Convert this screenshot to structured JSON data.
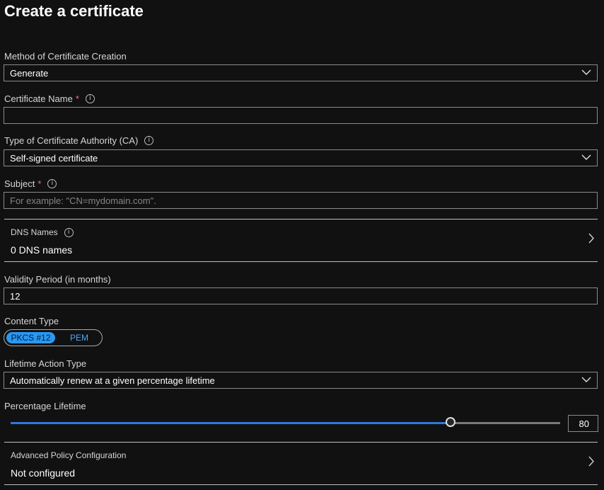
{
  "page": {
    "title": "Create a certificate"
  },
  "method": {
    "label": "Method of Certificate Creation",
    "value": "Generate"
  },
  "cert_name": {
    "label": "Certificate Name",
    "required_mark": "*",
    "info_icon": "i",
    "value": ""
  },
  "ca_type": {
    "label": "Type of Certificate Authority (CA)",
    "info_icon": "i",
    "value": "Self-signed certificate"
  },
  "subject": {
    "label": "Subject",
    "required_mark": "*",
    "info_icon": "i",
    "placeholder": "For example: \"CN=mydomain.com\"."
  },
  "dns": {
    "label": "DNS Names",
    "info_icon": "i",
    "value": "0 DNS names"
  },
  "validity": {
    "label": "Validity Period (in months)",
    "value": "12"
  },
  "content_type": {
    "label": "Content Type",
    "options": [
      "PKCS #12",
      "PEM"
    ],
    "selected": "PKCS #12"
  },
  "lifetime_action": {
    "label": "Lifetime Action Type",
    "value": "Automatically renew at a given percentage lifetime"
  },
  "percentage": {
    "label": "Percentage Lifetime",
    "value": "80",
    "fraction": 0.8
  },
  "advanced": {
    "label": "Advanced Policy Configuration",
    "value": "Not configured"
  },
  "colors": {
    "accent": "#2899f5",
    "slider_fill": "#2a7ae0",
    "required": "#f1707b",
    "background": "#111111"
  }
}
